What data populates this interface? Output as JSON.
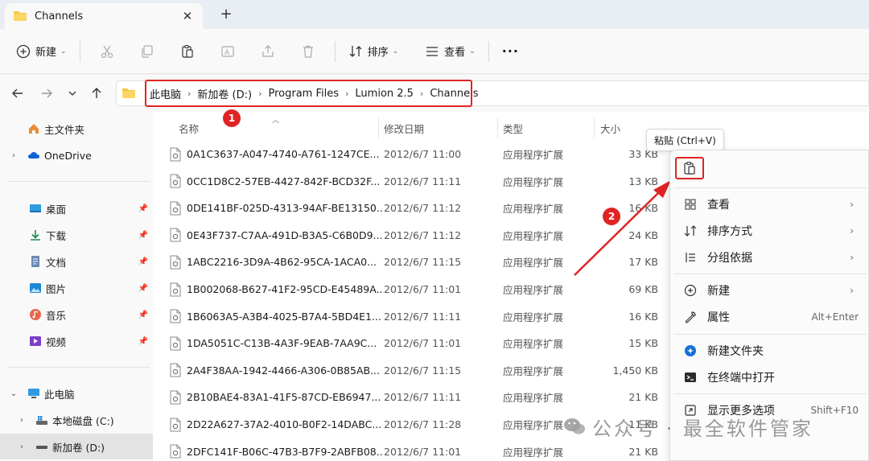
{
  "window": {
    "tab_title": "Channels",
    "close_glyph": "✕",
    "newtab_glyph": "+"
  },
  "toolbar": {
    "new_label": "新建",
    "sort_label": "排序",
    "view_label": "查看",
    "more_glyph": "···"
  },
  "address": {
    "crumbs": [
      "此电脑",
      "新加卷 (D:)",
      "Program Files",
      "Lumion 2.5",
      "Channels"
    ],
    "sep_glyph": "›"
  },
  "nav": {
    "home": "主文件夹",
    "onedrive": "OneDrive",
    "desktop": "桌面",
    "downloads": "下载",
    "documents": "文档",
    "pictures": "图片",
    "music": "音乐",
    "videos": "视频",
    "thispc": "此电脑",
    "local_c": "本地磁盘 (C:)",
    "new_d": "新加卷 (D:)"
  },
  "columns": {
    "name": "名称",
    "date": "修改日期",
    "type": "类型",
    "size": "大小"
  },
  "files": [
    {
      "name": "0A1C3637-A047-4740-A761-1247CE...",
      "date": "2012/6/7 11:00",
      "type": "应用程序扩展",
      "size": "33 KB"
    },
    {
      "name": "0CC1D8C2-57EB-4427-842F-BCD32F...",
      "date": "2012/6/7 11:11",
      "type": "应用程序扩展",
      "size": "13 KB"
    },
    {
      "name": "0DE141BF-025D-4313-94AF-BE13150...",
      "date": "2012/6/7 11:12",
      "type": "应用程序扩展",
      "size": "16 KB"
    },
    {
      "name": "0E43F737-C7AA-491D-B3A5-C6B0D9...",
      "date": "2012/6/7 11:12",
      "type": "应用程序扩展",
      "size": "24 KB"
    },
    {
      "name": "1ABC2216-3D9A-4B62-95CA-1ACA0...",
      "date": "2012/6/7 11:15",
      "type": "应用程序扩展",
      "size": "17 KB"
    },
    {
      "name": "1B002068-B627-41F2-95CD-E45489A...",
      "date": "2012/6/7 11:01",
      "type": "应用程序扩展",
      "size": "69 KB"
    },
    {
      "name": "1B6063A5-A3B4-4025-B7A4-5BD4E1...",
      "date": "2012/6/7 11:11",
      "type": "应用程序扩展",
      "size": "16 KB"
    },
    {
      "name": "1DA5051C-C13B-4A3F-9EAB-7AA9C...",
      "date": "2012/6/7 11:01",
      "type": "应用程序扩展",
      "size": "15 KB"
    },
    {
      "name": "2A4F38AA-1942-4466-A306-0B85AB...",
      "date": "2012/6/7 11:15",
      "type": "应用程序扩展",
      "size": "1,450 KB"
    },
    {
      "name": "2B10BAE4-83A1-41F5-87CD-EB6947...",
      "date": "2012/6/7 11:11",
      "type": "应用程序扩展",
      "size": "21 KB"
    },
    {
      "name": "2D22A627-37A2-4010-B0F2-14DABC...",
      "date": "2012/6/7 11:28",
      "type": "应用程序扩展",
      "size": "11 KB"
    },
    {
      "name": "2DFC141F-B06C-47B3-B7F9-2ABFB08...",
      "date": "2012/6/7 11:01",
      "type": "应用程序扩展",
      "size": "21 KB"
    }
  ],
  "tooltip": "粘贴 (Ctrl+V)",
  "context_menu": {
    "view": "查看",
    "sort": "排序方式",
    "group": "分组依据",
    "new": "新建",
    "properties": "属性",
    "properties_shortcut": "Alt+Enter",
    "new_folder": "新建文件夹",
    "terminal": "在终端中打开",
    "more": "显示更多选项",
    "more_shortcut": "Shift+F10"
  },
  "markers": {
    "one": "1",
    "two": "2"
  },
  "watermark": "公众号 · 最全软件管家",
  "colors": {
    "accent": "#0067c0",
    "marker": "#e02424",
    "folder": "#f5c542"
  }
}
